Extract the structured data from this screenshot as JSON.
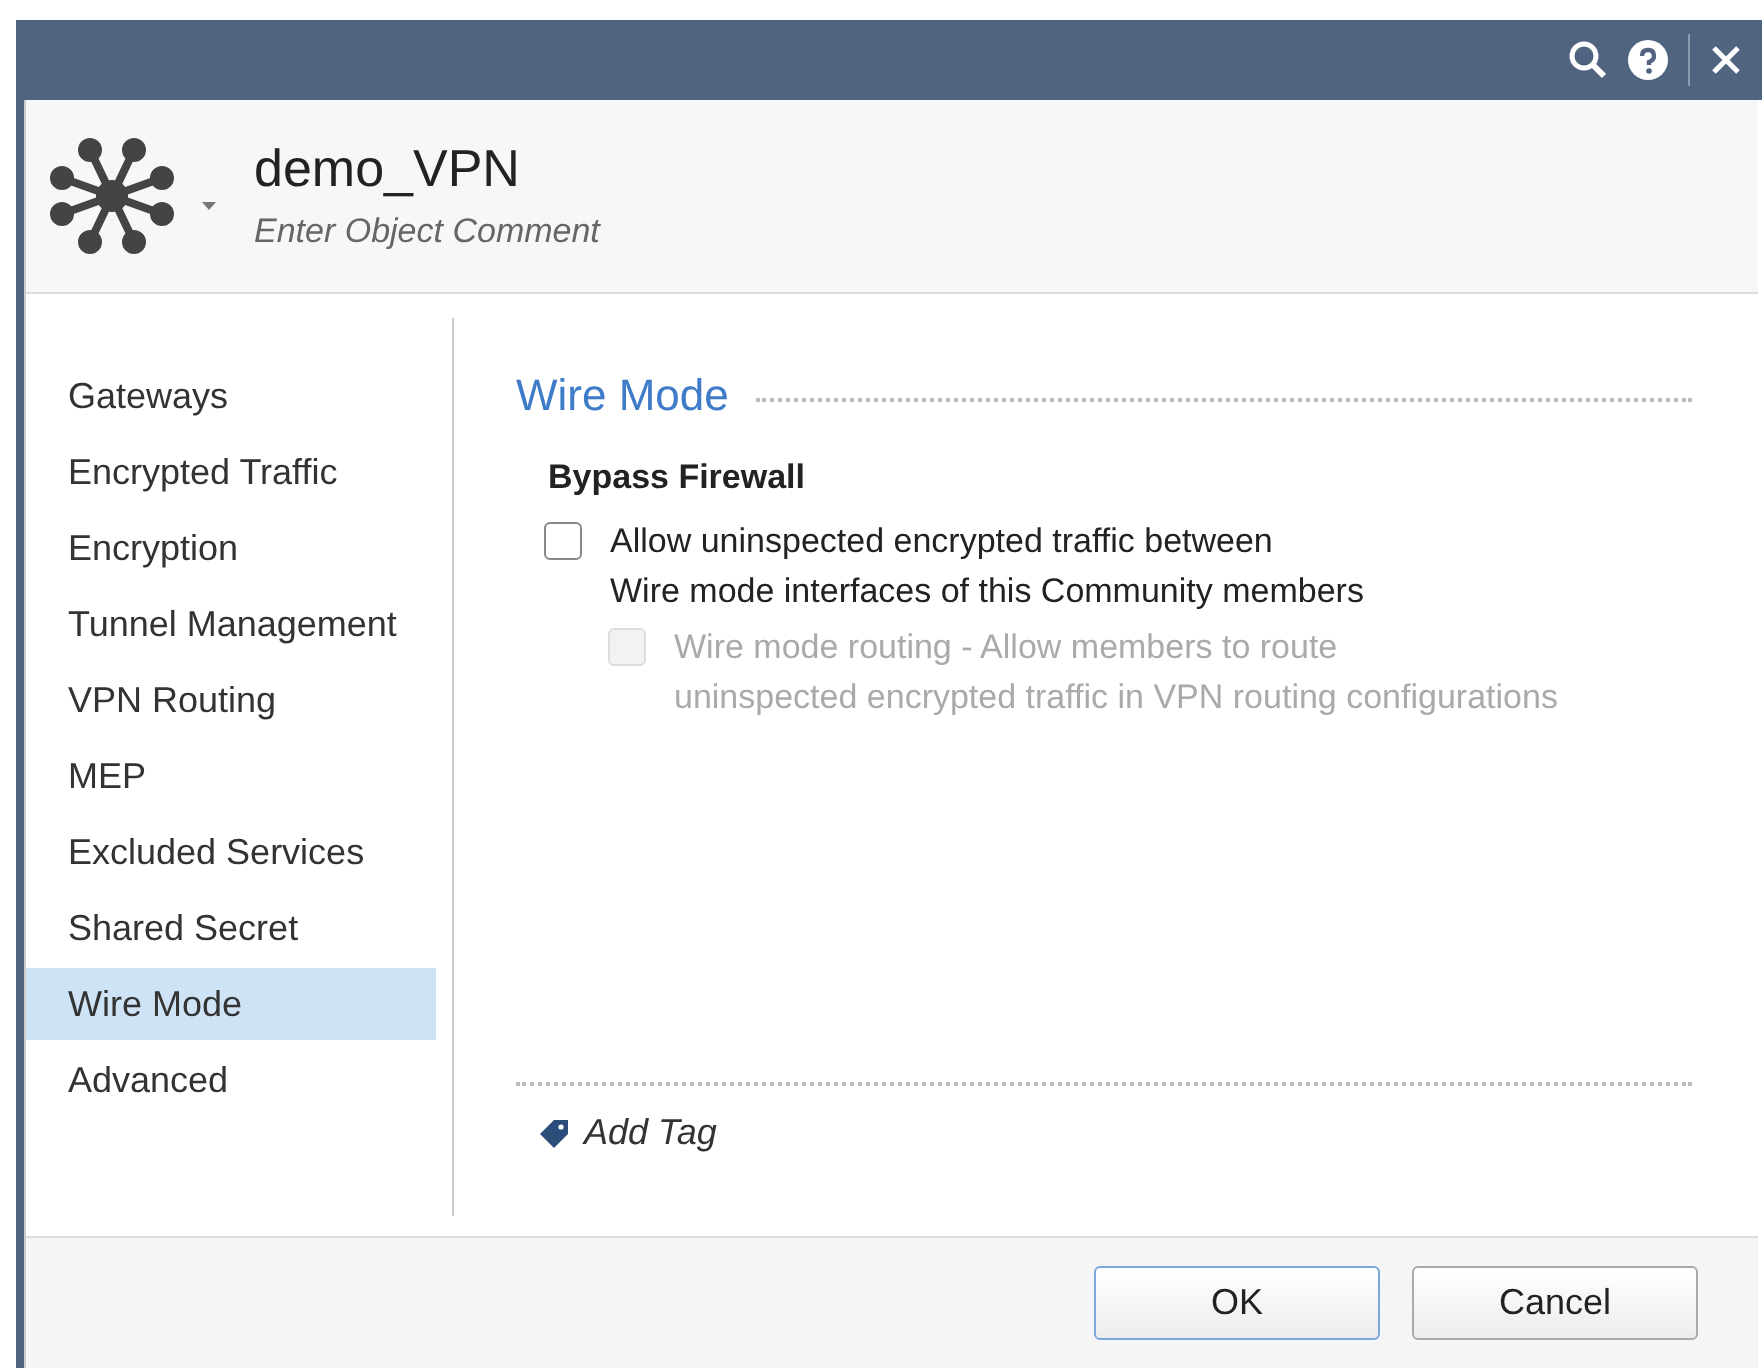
{
  "header": {
    "title": "demo_VPN",
    "comment_placeholder": "Enter Object Comment"
  },
  "sidebar": {
    "items": [
      {
        "label": "Gateways",
        "selected": false
      },
      {
        "label": "Encrypted Traffic",
        "selected": false
      },
      {
        "label": "Encryption",
        "selected": false
      },
      {
        "label": "Tunnel Management",
        "selected": false
      },
      {
        "label": "VPN Routing",
        "selected": false
      },
      {
        "label": "MEP",
        "selected": false
      },
      {
        "label": "Excluded Services",
        "selected": false
      },
      {
        "label": "Shared Secret",
        "selected": false
      },
      {
        "label": "Wire Mode",
        "selected": true
      },
      {
        "label": "Advanced",
        "selected": false
      }
    ]
  },
  "section": {
    "title": "Wire Mode",
    "group": "Bypass Firewall",
    "options": [
      {
        "label": "Allow uninspected encrypted traffic between\nWire mode interfaces of this Community members",
        "checked": false,
        "disabled": false,
        "nested": false
      },
      {
        "label": "Wire mode routing - Allow members to route\nuninspected encrypted traffic in VPN routing configurations",
        "checked": false,
        "disabled": true,
        "nested": true
      }
    ]
  },
  "add_tag": "Add Tag",
  "buttons": [
    "OK",
    "Cancel"
  ]
}
